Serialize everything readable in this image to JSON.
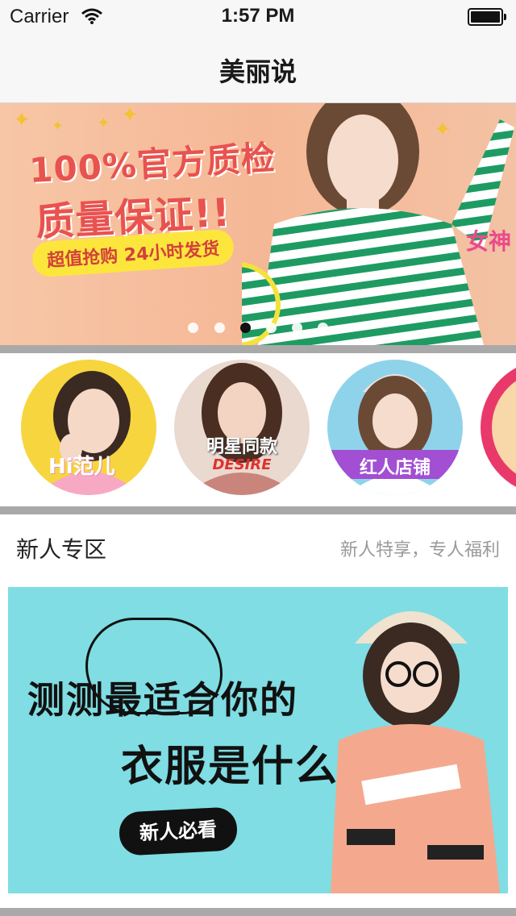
{
  "status_bar": {
    "carrier": "Carrier",
    "time": "1:57 PM"
  },
  "nav": {
    "title": "美丽说"
  },
  "banner": {
    "headline_1": "100%官方质检",
    "headline_2": "质量保证!!",
    "pill": "超值抢购 24小时发货",
    "tag": "女神",
    "page_count": 6,
    "active_page": 3,
    "colors": {
      "headline": "#e8524f",
      "pill": "#fde63c",
      "stripe": "#1e9b63"
    }
  },
  "categories": [
    {
      "label": "Hi范儿"
    },
    {
      "label": "明星同款",
      "sub": "DESIRE"
    },
    {
      "label": "红人店铺"
    }
  ],
  "section": {
    "title": "新人专区",
    "subtitle": "新人特享，专人福利"
  },
  "promo": {
    "line_1": "测测最适合你的",
    "line_2": "衣服是什么?",
    "button": "新人必看",
    "background": "#7fdde3"
  }
}
